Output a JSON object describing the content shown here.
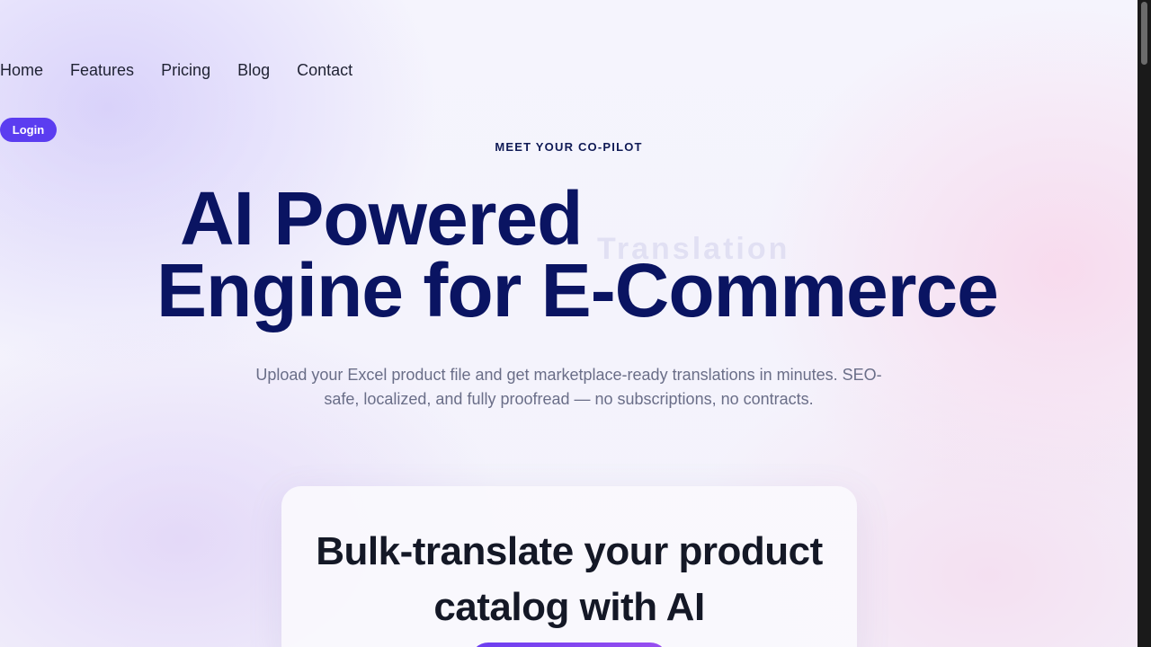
{
  "nav": {
    "items": [
      "Home",
      "Features",
      "Pricing",
      "Blog",
      "Contact"
    ],
    "login_label": "Login"
  },
  "hero": {
    "eyebrow": "MEET YOUR CO-PILOT",
    "headline_line1": "AI Powered",
    "headline_ghost_word": "Translation",
    "headline_line2": "Engine for E-Commerce",
    "subtitle": "Upload your Excel product file and get marketplace-ready translations in minutes. SEO-safe, localized, and fully proofread — no subscriptions, no contracts."
  },
  "card": {
    "title": "Bulk-translate your product catalog with AI"
  },
  "colors": {
    "accent": "#5b3df0",
    "headline": "#0a1462",
    "subtitle": "#6a6e88"
  }
}
